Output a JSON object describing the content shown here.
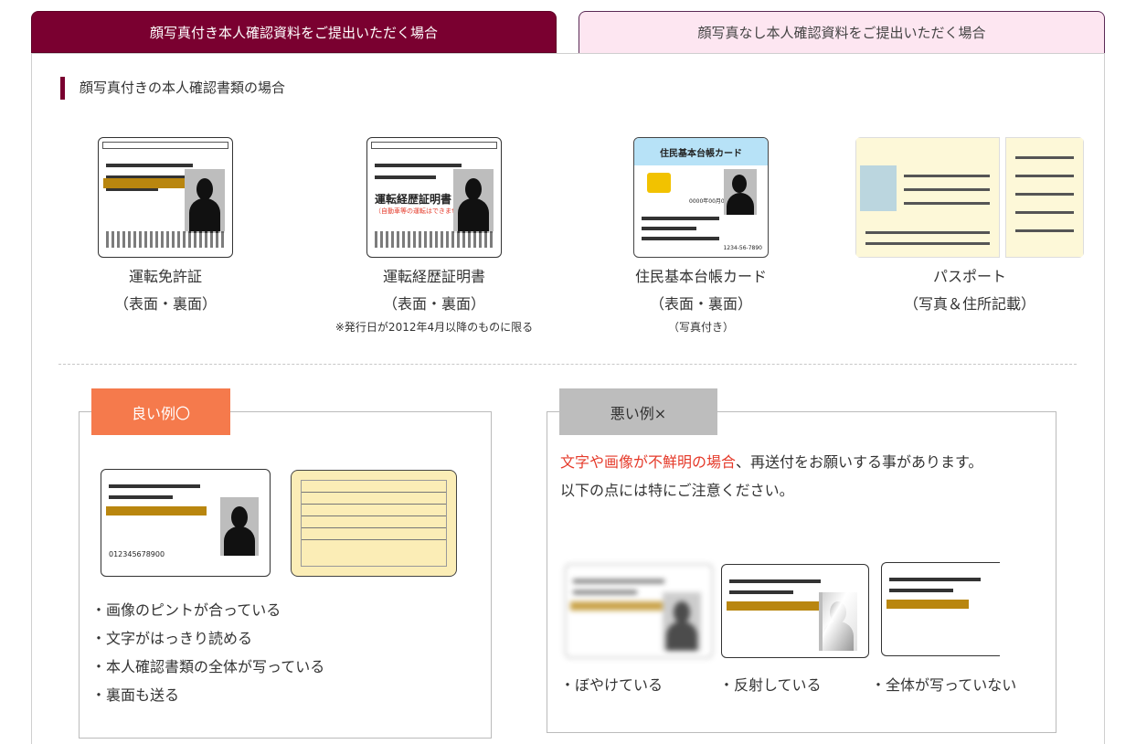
{
  "tabs": [
    {
      "label": "顔写真付き本人確認資料をご提出いただく場合",
      "active": true
    },
    {
      "label": "顔写真なし本人確認資料をご提出いただく場合",
      "active": false
    }
  ],
  "section": {
    "title": "顔写真付きの本人確認書類の場合"
  },
  "documents": [
    {
      "name": "運転免許証",
      "sub": "（表面・裏面）",
      "note": ""
    },
    {
      "name": "運転経歴証明書",
      "sub": "（表面・裏面）",
      "note": "※発行日が2012年4月以降のものに限る"
    },
    {
      "name": "住民基本台帳カード",
      "sub": "（表面・裏面）",
      "note": "（写真付き）"
    },
    {
      "name": "パスポート",
      "sub": "（写真＆住所記載）",
      "note": ""
    }
  ],
  "card_text": {
    "keireki_title": "運転経歴証明書",
    "keireki_warn": "（自動車等の運転はできません）",
    "jumin_title": "住民基本台帳カード",
    "jumin_date": "0000年00月00日まで有効",
    "jumin_number": "1234-56-7890",
    "license_number": "012345678900"
  },
  "good_example": {
    "label": "良い例〇",
    "points": [
      "・画像のピントが合っている",
      "・文字がはっきり読める",
      "・本人確認書類の全体が写っている",
      "・裏面も送る"
    ]
  },
  "bad_example": {
    "label": "悪い例×",
    "text_red": "文字や画像が不鮮明の場合",
    "text_rest": "、再送付をお願いする事があります。",
    "text_line2": "以下の点には特にご注意ください。",
    "captions": [
      "・ぼやけている",
      "・反射している",
      "・全体が写っていない"
    ]
  },
  "colors": {
    "primary": "#7a0030",
    "tab_inactive_bg": "#fde6f1",
    "good": "#f57a4c",
    "bad": "#bdbdbd",
    "alert_text": "#e53a2a"
  }
}
